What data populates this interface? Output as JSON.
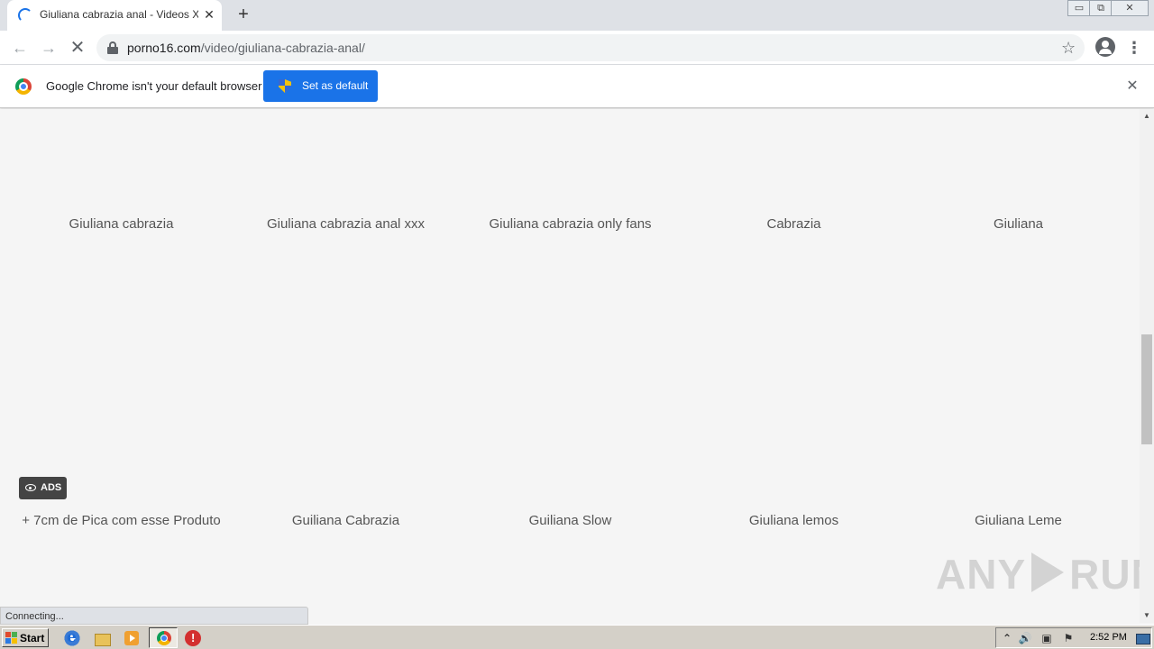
{
  "browser": {
    "tab_title": "Giuliana cabrazia anal - Videos Xxx |",
    "tab_close": "✕",
    "new_tab": "+",
    "url_host": "porno16.com",
    "url_path": "/video/giuliana-cabrazia-anal/",
    "back": "←",
    "forward": "→",
    "stop": "✕",
    "star": "☆",
    "menu": "⋮",
    "win_min": "▭",
    "win_max": "⧉",
    "win_close": "✕"
  },
  "infobar": {
    "message": "Google Chrome isn't your default browser",
    "button_label": "Set as default",
    "close": "✕"
  },
  "content": {
    "row1": [
      "Giuliana cabrazia",
      "Giuliana cabrazia anal xxx",
      "Giuliana cabrazia only fans",
      "Cabrazia",
      "Giuliana"
    ],
    "ads_label": "ADS",
    "row2": [
      "+ 7cm de Pica com esse Produto",
      "Guiliana Cabrazia",
      "Guiliana Slow",
      "Giuliana lemos",
      "Giuliana Leme"
    ],
    "watermark_left": "ANY",
    "watermark_right": "RUN"
  },
  "status": {
    "text": "Connecting..."
  },
  "scrollbar": {
    "up": "▲",
    "down": "▼"
  },
  "taskbar": {
    "start_label": "Start",
    "tray_up": "⌃",
    "tray_vol": "🔊",
    "tray_net": "▣",
    "tray_flag": "⚑",
    "clock": "2:52 PM"
  }
}
